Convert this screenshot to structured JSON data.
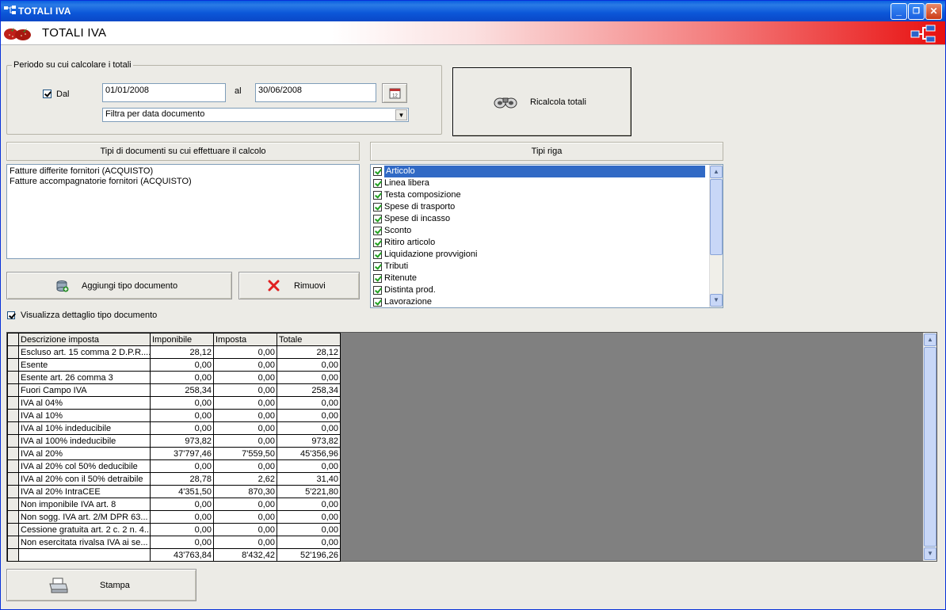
{
  "window": {
    "title": "TOTALI IVA",
    "controls": {
      "minimize": "_",
      "maximize": "❐",
      "close": "✕"
    }
  },
  "header": {
    "title": "TOTALI IVA"
  },
  "period": {
    "legend": "Periodo su cui calcolare i totali",
    "dal_label": "Dal",
    "dal_checked": true,
    "from_date": "01/01/2008",
    "al_label": "al",
    "to_date": "30/06/2008",
    "filter_selected": "Filtra per data documento"
  },
  "recalc_button": {
    "label": "Ricalcola totali"
  },
  "doc_types": {
    "header": "Tipi di documenti su cui effettuare il calcolo",
    "items": [
      "Fatture differite fornitori (ACQUISTO)",
      "Fatture accompagnatorie fornitori (ACQUISTO)"
    ]
  },
  "row_types": {
    "header": "Tipi riga",
    "items": [
      {
        "label": "Articolo",
        "checked": true,
        "selected": true
      },
      {
        "label": "Linea libera",
        "checked": true
      },
      {
        "label": "Testa composizione",
        "checked": true
      },
      {
        "label": "Spese di trasporto",
        "checked": true
      },
      {
        "label": "Spese di incasso",
        "checked": true
      },
      {
        "label": "Sconto",
        "checked": true
      },
      {
        "label": "Ritiro articolo",
        "checked": true
      },
      {
        "label": "Liquidazione provvigioni",
        "checked": true
      },
      {
        "label": "Tributi",
        "checked": true
      },
      {
        "label": "Ritenute",
        "checked": true
      },
      {
        "label": "Distinta prod.",
        "checked": true
      },
      {
        "label": "Lavorazione",
        "checked": true
      }
    ]
  },
  "buttons": {
    "add_doc_type": "Aggiungi tipo documento",
    "remove": "Rimuovi",
    "print": "Stampa"
  },
  "detail_toggle": {
    "label": "Visualizza dettaglio tipo documento",
    "checked": true
  },
  "grid": {
    "columns": [
      "Descrizione imposta",
      "Imponibile",
      "Imposta",
      "Totale"
    ],
    "rows": [
      [
        "Escluso art. 15 comma 2 D.P.R....",
        "28,12",
        "0,00",
        "28,12"
      ],
      [
        "Esente",
        "0,00",
        "0,00",
        "0,00"
      ],
      [
        "Esente art. 26 comma 3",
        "0,00",
        "0,00",
        "0,00"
      ],
      [
        "Fuori Campo IVA",
        "258,34",
        "0,00",
        "258,34"
      ],
      [
        "IVA al 04%",
        "0,00",
        "0,00",
        "0,00"
      ],
      [
        "IVA al 10%",
        "0,00",
        "0,00",
        "0,00"
      ],
      [
        "IVA al 10% indeducibile",
        "0,00",
        "0,00",
        "0,00"
      ],
      [
        "IVA al 100% indeducibile",
        "973,82",
        "0,00",
        "973,82"
      ],
      [
        "IVA al 20%",
        "37'797,46",
        "7'559,50",
        "45'356,96"
      ],
      [
        "IVA al 20% col 50% deducibile",
        "0,00",
        "0,00",
        "0,00"
      ],
      [
        "IVA al 20% con il 50% detraibile",
        "28,78",
        "2,62",
        "31,40"
      ],
      [
        "IVA al 20% IntraCEE",
        "4'351,50",
        "870,30",
        "5'221,80"
      ],
      [
        "Non imponibile IVA art. 8",
        "0,00",
        "0,00",
        "0,00"
      ],
      [
        "Non sogg. IVA art. 2/M DPR 63...",
        "0,00",
        "0,00",
        "0,00"
      ],
      [
        "Cessione gratuita art. 2 c. 2 n. 4...",
        "0,00",
        "0,00",
        "0,00"
      ],
      [
        "Non esercitata rivalsa IVA ai se...",
        "0,00",
        "0,00",
        "0,00"
      ]
    ],
    "totals": [
      "",
      "43'763,84",
      "8'432,42",
      "52'196,26"
    ]
  },
  "icons": {
    "app": "network-icon",
    "header_logo": "strawberries-icon",
    "header_right": "tree-structure-icon",
    "calendar": "calendar-icon",
    "binoculars": "binoculars-icon",
    "add": "database-add-icon",
    "remove": "red-x-icon",
    "print": "printer-icon"
  },
  "colors": {
    "titlebar": "#0a5fe0",
    "header_gradient_end": "#e81010",
    "selection": "#316ac5",
    "grid_background": "#808080",
    "remove_icon": "#e02020"
  }
}
